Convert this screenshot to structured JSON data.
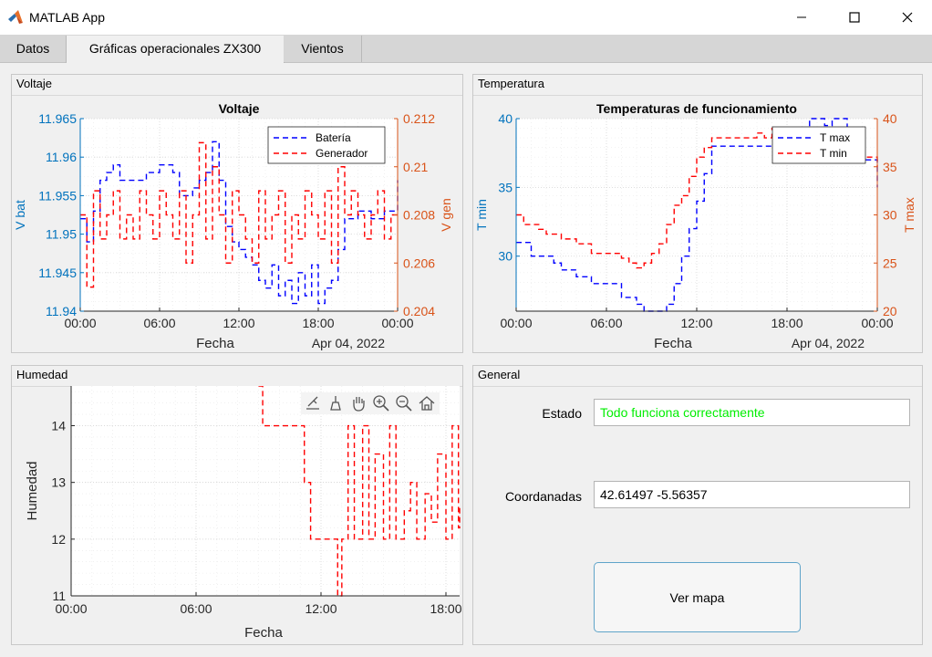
{
  "window": {
    "title": "MATLAB App"
  },
  "tabs": [
    {
      "label": "Datos",
      "active": false
    },
    {
      "label": "Gráficas operacionales ZX300",
      "active": true
    },
    {
      "label": "Vientos",
      "active": false
    }
  ],
  "panels": {
    "voltaje": "Voltaje",
    "temperatura": "Temperatura",
    "humedad": "Humedad",
    "general": "General"
  },
  "general": {
    "estado_label": "Estado",
    "estado_value": "Todo funciona correctamente",
    "coordenadas_label": "Coordanadas",
    "coordenadas_value": "42.61497 -5.56357",
    "map_button": "Ver mapa"
  },
  "colors": {
    "left_axis": "#0072bd",
    "right_axis": "#d95319",
    "series_blue": "#0000ff",
    "series_red": "#ff0000",
    "status_text": "#00ee00"
  },
  "chart_data": [
    {
      "type": "line",
      "title": "Voltaje",
      "xlabel": "Fecha",
      "date_label": "Apr 04, 2022",
      "x_ticks": [
        "00:00",
        "06:00",
        "12:00",
        "18:00",
        "00:00"
      ],
      "x_range_hours": [
        0,
        24
      ],
      "ylabel_left": "V bat",
      "ylabel_right": "V gen",
      "ylim_left": [
        11.94,
        11.965
      ],
      "ylim_right": [
        0.204,
        0.212
      ],
      "yticks_left": [
        "11.94",
        "11.945",
        "11.95",
        "11.955",
        "11.96",
        "11.965"
      ],
      "yticks_right": [
        "0.204",
        "0.206",
        "0.208",
        "0.21",
        "0.212"
      ],
      "grid": true,
      "legend_position": "top-right",
      "series": [
        {
          "name": "Batería",
          "axis": "left",
          "style": "dashed",
          "x": [
            0,
            0.5,
            1,
            1.5,
            2,
            2.5,
            3,
            4,
            5,
            6,
            7,
            7.5,
            8,
            8.5,
            9,
            9.5,
            10,
            10.5,
            11,
            11.5,
            12,
            12.5,
            13,
            13.5,
            14,
            14.5,
            15,
            15.5,
            16,
            16.5,
            17,
            17.5,
            18,
            18.5,
            19,
            19.5,
            20,
            21,
            22,
            23,
            24
          ],
          "values": [
            11.952,
            11.949,
            11.953,
            11.957,
            11.958,
            11.959,
            11.957,
            11.957,
            11.958,
            11.959,
            11.958,
            11.955,
            11.955,
            11.956,
            11.957,
            11.958,
            11.962,
            11.957,
            11.951,
            11.949,
            11.948,
            11.947,
            11.946,
            11.944,
            11.943,
            11.946,
            11.942,
            11.944,
            11.941,
            11.945,
            11.942,
            11.946,
            11.941,
            11.943,
            11.944,
            11.948,
            11.952,
            11.953,
            11.952,
            11.953,
            11.957
          ]
        },
        {
          "name": "Generador",
          "axis": "right",
          "style": "dashed",
          "x": [
            0,
            0.5,
            1,
            1.5,
            2,
            2.5,
            3,
            3.5,
            4,
            4.5,
            5,
            5.5,
            6,
            6.5,
            7,
            7.5,
            8,
            8.5,
            9,
            9.5,
            10,
            10.5,
            11,
            11.5,
            12,
            12.5,
            13,
            13.5,
            14,
            14.5,
            15,
            15.5,
            16,
            16.5,
            17,
            17.5,
            18,
            18.5,
            19,
            19.5,
            20,
            20.5,
            21,
            21.5,
            22,
            22.5,
            23,
            23.5,
            24
          ],
          "values": [
            0.208,
            0.205,
            0.209,
            0.207,
            0.208,
            0.209,
            0.207,
            0.208,
            0.207,
            0.209,
            0.208,
            0.207,
            0.209,
            0.208,
            0.207,
            0.209,
            0.206,
            0.208,
            0.211,
            0.207,
            0.21,
            0.208,
            0.206,
            0.209,
            0.208,
            0.207,
            0.206,
            0.209,
            0.207,
            0.208,
            0.209,
            0.206,
            0.208,
            0.207,
            0.209,
            0.208,
            0.207,
            0.209,
            0.206,
            0.21,
            0.208,
            0.209,
            0.208,
            0.207,
            0.208,
            0.209,
            0.207,
            0.208,
            0.208
          ]
        }
      ]
    },
    {
      "type": "line",
      "title": "Temperaturas de funcionamiento",
      "xlabel": "Fecha",
      "date_label": "Apr 04, 2022",
      "x_ticks": [
        "00:00",
        "06:00",
        "12:00",
        "18:00",
        "00:00"
      ],
      "x_range_hours": [
        0,
        24
      ],
      "ylabel_left": "T min",
      "ylabel_right": "T max",
      "ylim_left": [
        26,
        40
      ],
      "ylim_right": [
        20,
        40
      ],
      "yticks_left": [
        "30",
        "35",
        "40"
      ],
      "yticks_right": [
        "20",
        "25",
        "30",
        "35",
        "40"
      ],
      "grid": true,
      "legend_position": "top-right",
      "series": [
        {
          "name": "T max",
          "axis": "left",
          "style": "dashed",
          "x": [
            0,
            0.5,
            1,
            2,
            2.5,
            3,
            4,
            5,
            6,
            7,
            7.5,
            8,
            8.5,
            9,
            9.5,
            10,
            10.5,
            11,
            11.5,
            12,
            12.5,
            13,
            14,
            15,
            16,
            17,
            18,
            18.5,
            19,
            19.5,
            20,
            20.5,
            21,
            22,
            23,
            24
          ],
          "values": [
            31,
            31,
            30,
            30,
            29.5,
            29,
            28.5,
            28,
            28,
            27,
            27,
            26.5,
            26,
            26,
            26,
            26.5,
            28,
            30,
            32,
            34,
            36,
            38,
            38,
            38,
            38,
            38,
            38,
            39,
            38,
            40,
            40,
            39.5,
            40,
            39,
            37,
            35
          ]
        },
        {
          "name": "T min",
          "axis": "right",
          "style": "dashed",
          "x": [
            0,
            0.5,
            1,
            1.5,
            2,
            3,
            4,
            5,
            6,
            7,
            7.5,
            8,
            8.5,
            9,
            9.5,
            10,
            10.5,
            11,
            11.5,
            12,
            12.5,
            13,
            14,
            15,
            16,
            16.5,
            17,
            17.5,
            18,
            19,
            20,
            21,
            22,
            23,
            24
          ],
          "values": [
            30,
            29,
            29,
            28.5,
            28,
            27.5,
            27,
            26,
            26,
            25.5,
            25,
            24.5,
            25,
            26,
            27,
            29,
            31,
            32,
            34,
            36,
            37,
            38,
            38,
            38,
            38.5,
            38,
            39,
            38,
            38,
            37,
            38,
            37,
            38,
            36,
            35
          ]
        }
      ]
    },
    {
      "type": "line",
      "title": "",
      "xlabel": "Fecha",
      "x_ticks": [
        "00:00",
        "06:00",
        "12:00",
        "18:00"
      ],
      "x_range_hours": [
        0,
        19
      ],
      "ylabel": "Humedad",
      "ylim": [
        11,
        14.7
      ],
      "yticks": [
        "11",
        "12",
        "13",
        "14"
      ],
      "grid": true,
      "series": [
        {
          "name": "",
          "style": "dashed",
          "x": [
            9,
            9.2,
            10.5,
            11.2,
            11.5,
            12,
            12.5,
            12.8,
            13,
            13.3,
            13.6,
            14,
            14.3,
            14.6,
            15,
            15.3,
            15.6,
            16,
            16.3,
            16.6,
            17,
            17.3,
            17.6,
            18,
            18.3,
            18.6,
            19
          ],
          "values": [
            14.7,
            14,
            14,
            13,
            12,
            12,
            12,
            11,
            12,
            14,
            12,
            14,
            12,
            13.5,
            12,
            14,
            12,
            12.5,
            13,
            12,
            12.8,
            12.3,
            13.5,
            12,
            14,
            12.2,
            12.6
          ]
        }
      ]
    }
  ]
}
